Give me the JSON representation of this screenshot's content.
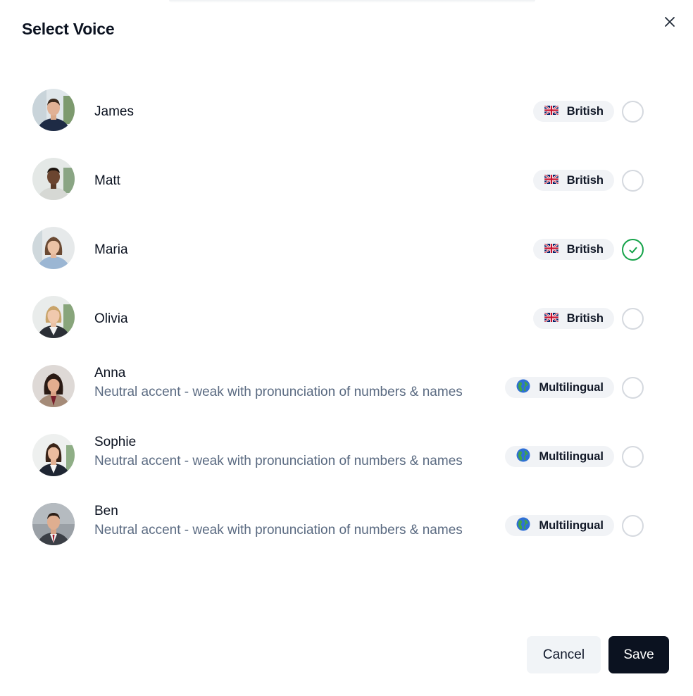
{
  "dialog": {
    "title": "Select Voice",
    "close_icon": "close-icon"
  },
  "voices": [
    {
      "name": "James",
      "description": "",
      "badge": "British",
      "badge_icon": "uk-flag-icon",
      "selected": false
    },
    {
      "name": "Matt",
      "description": "",
      "badge": "British",
      "badge_icon": "uk-flag-icon",
      "selected": false
    },
    {
      "name": "Maria",
      "description": "",
      "badge": "British",
      "badge_icon": "uk-flag-icon",
      "selected": true
    },
    {
      "name": "Olivia",
      "description": "",
      "badge": "British",
      "badge_icon": "uk-flag-icon",
      "selected": false
    },
    {
      "name": "Anna",
      "description": "Neutral accent - weak with pronunciation of numbers & names",
      "badge": "Multilingual",
      "badge_icon": "globe-icon",
      "selected": false
    },
    {
      "name": "Sophie",
      "description": "Neutral accent - weak with pronunciation of numbers & names",
      "badge": "Multilingual",
      "badge_icon": "globe-icon",
      "selected": false
    },
    {
      "name": "Ben",
      "description": "Neutral accent - weak with pronunciation of numbers & names",
      "badge": "Multilingual",
      "badge_icon": "globe-icon",
      "selected": false
    }
  ],
  "footer": {
    "cancel_label": "Cancel",
    "save_label": "Save"
  },
  "colors": {
    "primary": "#0b1220",
    "selected": "#16a34a",
    "muted_text": "#5b6b82",
    "badge_bg": "#f1f3f6"
  }
}
